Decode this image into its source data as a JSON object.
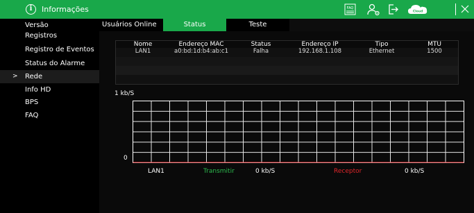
{
  "titlebar": {
    "title": "Informações",
    "info_icon_glyph": "i",
    "icons": [
      "faq-icon",
      "user-settings-icon",
      "logout-icon",
      "cloud-icon",
      "close-icon"
    ],
    "faq_label": "FAQ",
    "cloud_label": "Cloud",
    "color": "#19a84a"
  },
  "sidebar": {
    "items": [
      {
        "label": "Versão",
        "active": false
      },
      {
        "label": "Registros",
        "active": false
      },
      {
        "label": "Registro de Eventos",
        "active": false
      },
      {
        "label": "Status do Alarme",
        "active": false
      },
      {
        "label": "Rede",
        "active": true
      },
      {
        "label": "Info HD",
        "active": false
      },
      {
        "label": "BPS",
        "active": false
      },
      {
        "label": "FAQ",
        "active": false
      }
    ],
    "active_arrow": ">"
  },
  "tabs": [
    {
      "label": "Usuários Online",
      "active": false
    },
    {
      "label": "Status",
      "active": true
    },
    {
      "label": "Teste",
      "active": false
    }
  ],
  "table": {
    "columns": [
      "Nome",
      "Endereço MAC",
      "Status",
      "Endereço IP",
      "Tipo",
      "MTU"
    ],
    "rows": [
      [
        "LAN1",
        "a0:bd:1d:b4:ab:c1",
        "Falha",
        "192.168.1.108",
        "Ethernet",
        "1500"
      ]
    ]
  },
  "graph": {
    "y_top_label": "1 kb/S",
    "y_bottom_label": "0",
    "grid_cols": 18,
    "grid_rows": 6,
    "legend": {
      "interface": "LAN1",
      "transmit_label": "Transmitir",
      "transmit_value": "0 kb/S",
      "receive_label": "Receptor",
      "receive_value": "0 kb/S",
      "transmit_color": "#2dbb4e",
      "receive_color": "#e0262a"
    }
  }
}
